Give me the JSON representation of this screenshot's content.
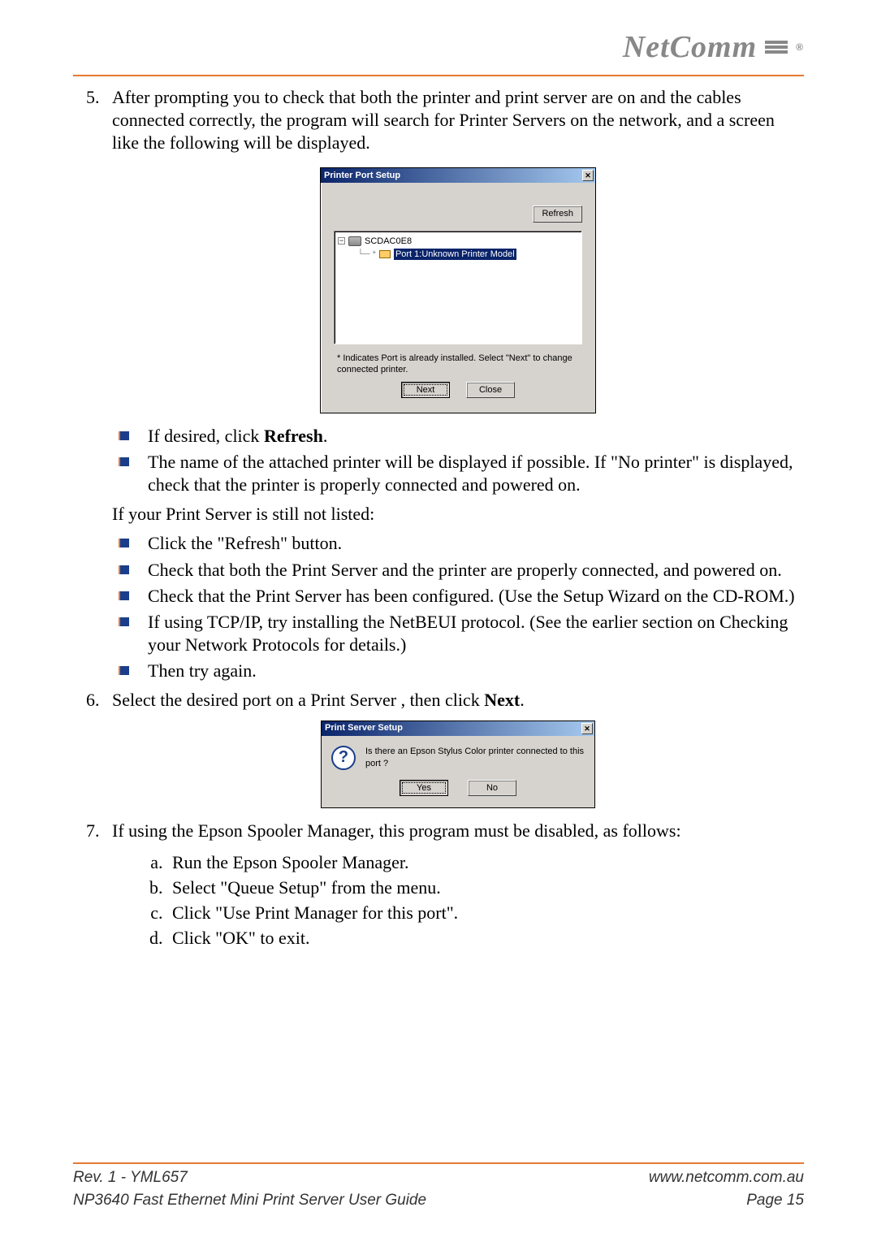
{
  "brand": "NetComm",
  "list_start": 5,
  "step5": {
    "text": "After prompting you to check that both the printer and print server are on and the cables connected correctly, the program will search for Printer Servers on the network, and a screen like the following will be displayed."
  },
  "dialog1": {
    "title": "Printer Port Setup",
    "refresh": "Refresh",
    "server_name": "SCDAC0E8",
    "port_label": "Port 1:Unknown Printer Model",
    "hint": "* Indicates Port is already installed. Select \"Next\" to change connected printer.",
    "next": "Next",
    "close_btn": "Close"
  },
  "bullets1": {
    "a_prefix": "If desired, click ",
    "a_bold": "Refresh",
    "a_suffix": ".",
    "b": "The name of the attached printer will be displayed if possible. If \"No printer\" is displayed, check that the printer is properly connected and powered on."
  },
  "still_not_listed": "If your Print Server is still not listed:",
  "bullets2": {
    "a": "Click the \"Refresh\" button.",
    "b": "Check that both the Print Server and the printer are properly connected, and powered on.",
    "c": "Check that the Print Server has been configured. (Use the Setup Wizard on the CD-ROM.)",
    "d": "If using TCP/IP, try installing the NetBEUI protocol. (See the earlier section on Checking your Network Protocols for details.)",
    "e": "Then try again."
  },
  "step6": {
    "prefix": "Select the desired port on a Print Server , then click ",
    "bold": "Next",
    "suffix": "."
  },
  "dialog2": {
    "title": "Print Server Setup",
    "message": "Is there an Epson Stylus Color printer connected to this port ?",
    "yes": "Yes",
    "no": "No"
  },
  "step7": {
    "text": "If using the Epson Spooler Manager, this program must be disabled, as follows:",
    "a": "Run the Epson Spooler Manager.",
    "b": "Select \"Queue Setup\" from the menu.",
    "c": "Click \"Use Print Manager for this port\".",
    "d": "Click \"OK\" to exit."
  },
  "footer": {
    "rev": "Rev. 1 - YML657",
    "url": "www.netcomm.com.au",
    "title": "NP3640 Fast Ethernet Mini Print Server User Guide",
    "page": "Page 15"
  }
}
